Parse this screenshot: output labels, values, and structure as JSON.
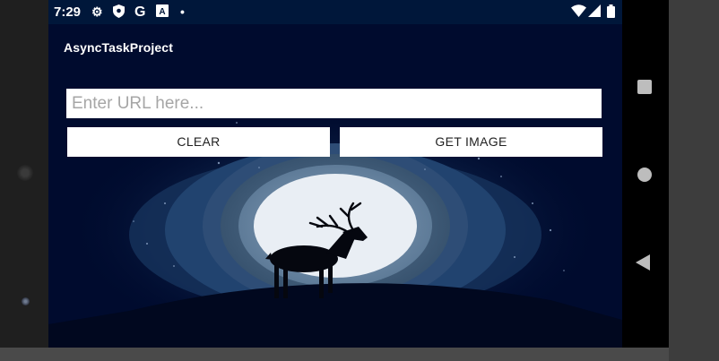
{
  "status_bar": {
    "time": "7:29",
    "icons": [
      "settings-icon",
      "shield-icon",
      "google-g-icon",
      "font-a-icon",
      "dot-icon",
      "wifi-icon",
      "signal-icon",
      "battery-icon"
    ]
  },
  "app": {
    "title": "AsyncTaskProject"
  },
  "url_input": {
    "placeholder": "Enter URL here...",
    "value": ""
  },
  "buttons": {
    "clear_label": "CLEAR",
    "get_image_label": "GET IMAGE"
  },
  "image": {
    "subject": "moon-deer-illustration-image"
  },
  "nav": {
    "icons": [
      "overview-square-icon",
      "home-circle-icon",
      "back-triangle-icon"
    ]
  },
  "colors": {
    "screen_bg": "#000b2e",
    "status_bg": "#00173a",
    "button_bg": "#ffffff",
    "moon": "#e9eef4"
  }
}
